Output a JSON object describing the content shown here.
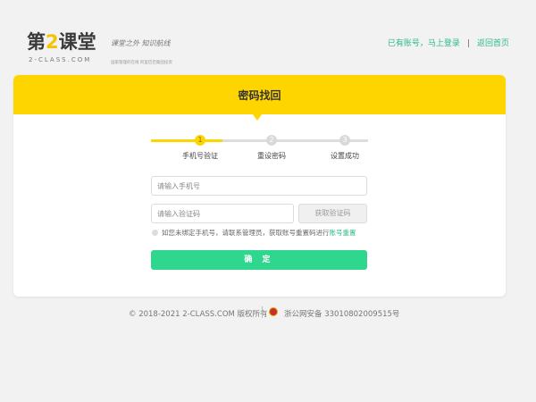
{
  "header": {
    "logo_prefix": "第",
    "logo_num": "2",
    "logo_suffix": "课堂",
    "logo_sub": "2-CLASS.COM",
    "slogan": "课堂之外  知识航线",
    "slogan_sub": "国家管理的在线 阿里巴巴集团投资",
    "nav_login_text": "已有账号，马上登录",
    "nav_separator": "|",
    "nav_home": "返回首页"
  },
  "card": {
    "title": "密码找回",
    "steps": [
      {
        "number": "1",
        "label": "手机号验证"
      },
      {
        "number": "2",
        "label": "重设密码"
      },
      {
        "number": "3",
        "label": "设置成功"
      }
    ],
    "active_step": 1,
    "phone_placeholder": "请输入手机号",
    "code_placeholder": "请输入验证码",
    "get_code_label": "获取验证码",
    "tip_text": "如您未绑定手机号，请联系管理员，获取账号重置码进行",
    "tip_link": "账号重置",
    "confirm_label": "确 定"
  },
  "footer": {
    "copyright": "© 2018-2021 2-CLASS.COM 版权所有",
    "icp": "浙公网安备 33010802009515号"
  },
  "colors": {
    "brand_yellow": "#ffd500",
    "accent_green": "#2ed68e",
    "link_green": "#2dbb86"
  }
}
